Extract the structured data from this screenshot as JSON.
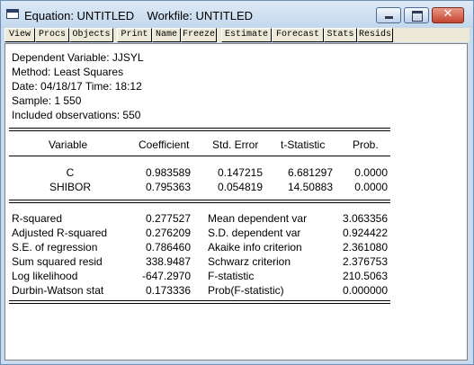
{
  "window": {
    "title": "Equation: UNTITLED    Workfile: UNTITLED",
    "buttons": {
      "minimize": "minimize",
      "maximize": "maximize",
      "close": "✕"
    }
  },
  "toolbar": [
    "View",
    "Procs",
    "Objects",
    "Print",
    "Name",
    "Freeze",
    "Estimate",
    "Forecast",
    "Stats",
    "Resids"
  ],
  "header": {
    "dependent": "Dependent Variable: JJSYL",
    "method": "Method: Least Squares",
    "date": "Date: 04/18/17   Time: 18:12",
    "sample": "Sample: 1 550",
    "obs": "Included observations: 550"
  },
  "coef_table": {
    "columns": [
      "Variable",
      "Coefficient",
      "Std. Error",
      "t-Statistic",
      "Prob."
    ],
    "rows": [
      {
        "variable": "C",
        "coefficient": "0.983589",
        "std_error": "0.147215",
        "t_stat": "6.681297",
        "prob": "0.0000"
      },
      {
        "variable": "SHIBOR",
        "coefficient": "0.795363",
        "std_error": "0.054819",
        "t_stat": "14.50883",
        "prob": "0.0000"
      }
    ]
  },
  "stats": [
    {
      "label": "R-squared",
      "value": "0.277527",
      "label2": "Mean dependent var",
      "value2": "3.063356"
    },
    {
      "label": "Adjusted R-squared",
      "value": "0.276209",
      "label2": "S.D. dependent var",
      "value2": "0.924422"
    },
    {
      "label": "S.E. of regression",
      "value": "0.786460",
      "label2": "Akaike info criterion",
      "value2": "2.361080"
    },
    {
      "label": "Sum squared resid",
      "value": "338.9487",
      "label2": "Schwarz criterion",
      "value2": "2.376753"
    },
    {
      "label": "Log likelihood",
      "value": "-647.2970",
      "label2": "F-statistic",
      "value2": "210.5063"
    },
    {
      "label": "Durbin-Watson stat",
      "value": "0.173336",
      "label2": "Prob(F-statistic)",
      "value2": "0.000000"
    }
  ]
}
